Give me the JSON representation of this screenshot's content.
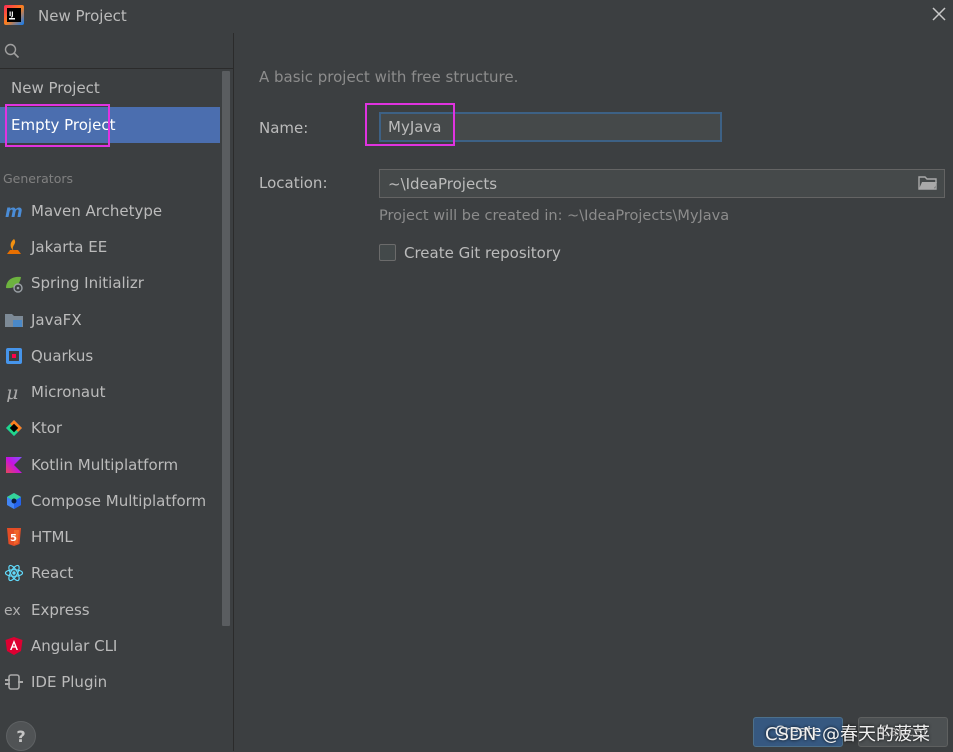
{
  "window": {
    "title": "New Project",
    "close_icon": "close-icon",
    "app_icon": "intellij-idea-icon"
  },
  "sidebar": {
    "search": {
      "placeholder": "",
      "value": ""
    },
    "project_types": [
      {
        "label": "New Project",
        "selected": false
      },
      {
        "label": "Empty Project",
        "selected": true
      }
    ],
    "generators_header": "Generators",
    "generators": [
      {
        "label": "Maven Archetype",
        "icon": "maven-icon"
      },
      {
        "label": "Jakarta EE",
        "icon": "jakarta-ee-icon"
      },
      {
        "label": "Spring Initializr",
        "icon": "spring-icon"
      },
      {
        "label": "JavaFX",
        "icon": "javafx-icon"
      },
      {
        "label": "Quarkus",
        "icon": "quarkus-icon"
      },
      {
        "label": "Micronaut",
        "icon": "micronaut-icon"
      },
      {
        "label": "Ktor",
        "icon": "ktor-icon"
      },
      {
        "label": "Kotlin Multiplatform",
        "icon": "kotlin-icon"
      },
      {
        "label": "Compose Multiplatform",
        "icon": "compose-icon"
      },
      {
        "label": "HTML",
        "icon": "html5-icon"
      },
      {
        "label": "React",
        "icon": "react-icon"
      },
      {
        "label": "Express",
        "icon": "express-icon"
      },
      {
        "label": "Angular CLI",
        "icon": "angular-icon"
      },
      {
        "label": "IDE Plugin",
        "icon": "plugin-icon"
      }
    ],
    "help_label": "?"
  },
  "main": {
    "description": "A basic project with free structure.",
    "name_label": "Name:",
    "name_value": "MyJava",
    "location_label": "Location:",
    "location_value": "~\\IdeaProjects",
    "location_hint": "Project will be created in: ~\\IdeaProjects\\MyJava",
    "git_checkbox_label": "Create Git repository",
    "git_checked": false
  },
  "footer": {
    "create_label": "Create",
    "cancel_label": "Cancel"
  },
  "watermark": "CSDN @春天的菠菜",
  "colors": {
    "background": "#3c3f41",
    "selection": "#4b6eaf",
    "highlight_box": "#e033e0",
    "field_focus_border": "#3d6185"
  }
}
